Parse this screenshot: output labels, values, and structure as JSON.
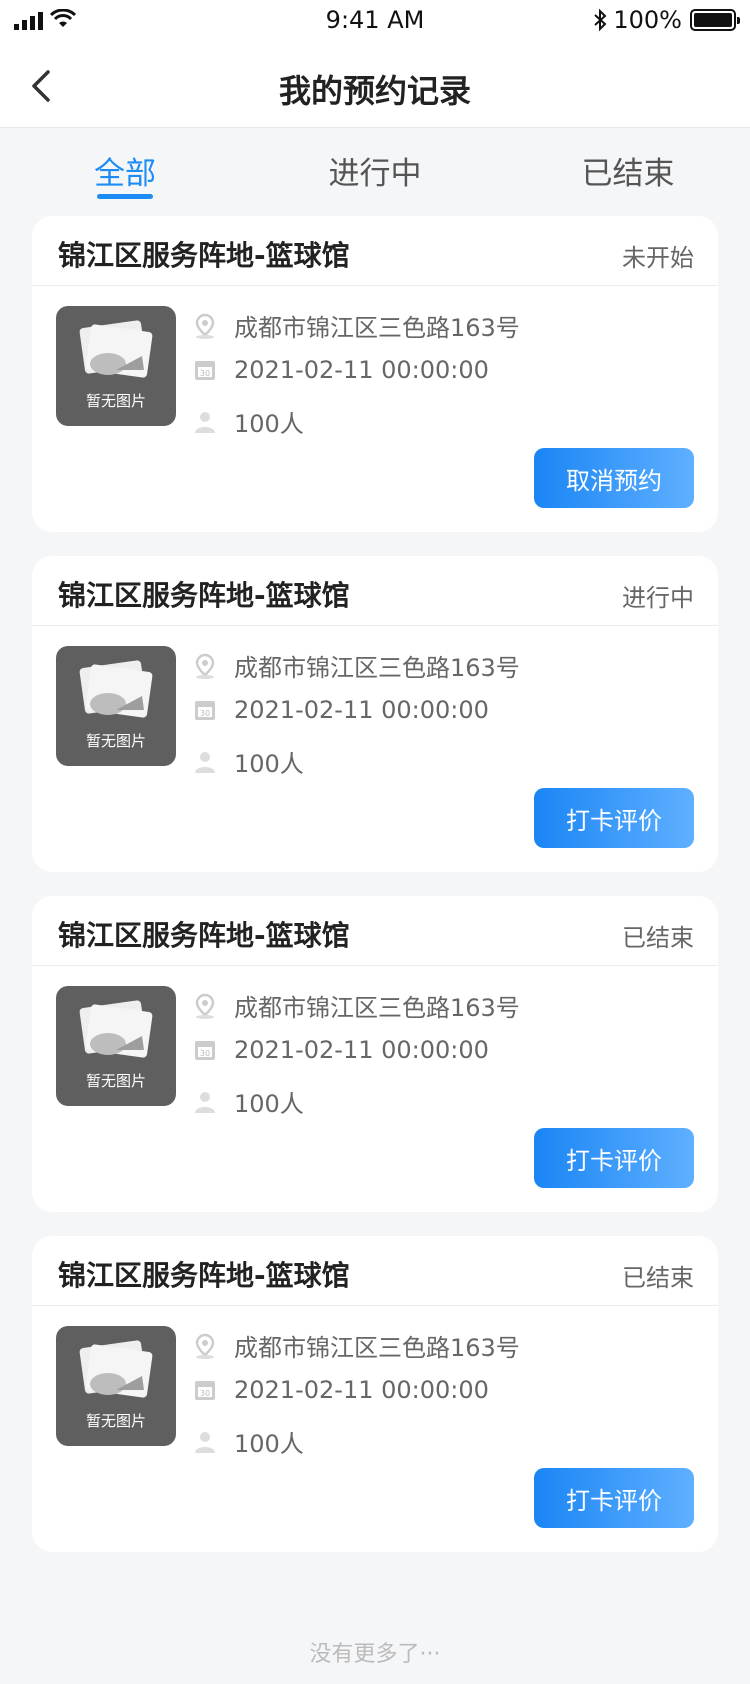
{
  "status_bar": {
    "time": "9:41 AM",
    "battery": "100%"
  },
  "nav": {
    "title": "我的预约记录"
  },
  "tabs": [
    {
      "label": "全部",
      "active": true
    },
    {
      "label": "进行中",
      "active": false
    },
    {
      "label": "已结束",
      "active": false
    }
  ],
  "records": [
    {
      "title": "锦江区服务阵地-篮球馆",
      "status": "未开始",
      "thumb_label": "暂无图片",
      "address": "成都市锦江区三色路163号",
      "datetime": "2021-02-11 00:00:00",
      "people": "100人",
      "action": "取消预约"
    },
    {
      "title": "锦江区服务阵地-篮球馆",
      "status": "进行中",
      "thumb_label": "暂无图片",
      "address": "成都市锦江区三色路163号",
      "datetime": "2021-02-11 00:00:00",
      "people": "100人",
      "action": "打卡评价"
    },
    {
      "title": "锦江区服务阵地-篮球馆",
      "status": "已结束",
      "thumb_label": "暂无图片",
      "address": "成都市锦江区三色路163号",
      "datetime": "2021-02-11 00:00:00",
      "people": "100人",
      "action": "打卡评价"
    },
    {
      "title": "锦江区服务阵地-篮球馆",
      "status": "已结束",
      "thumb_label": "暂无图片",
      "address": "成都市锦江区三色路163号",
      "datetime": "2021-02-11 00:00:00",
      "people": "100人",
      "action": "打卡评价"
    }
  ],
  "footer": {
    "note": "没有更多了···"
  },
  "colors": {
    "accent": "#1e8cf5",
    "button_start": "#1a85f5",
    "button_end": "#5fb0ff"
  }
}
